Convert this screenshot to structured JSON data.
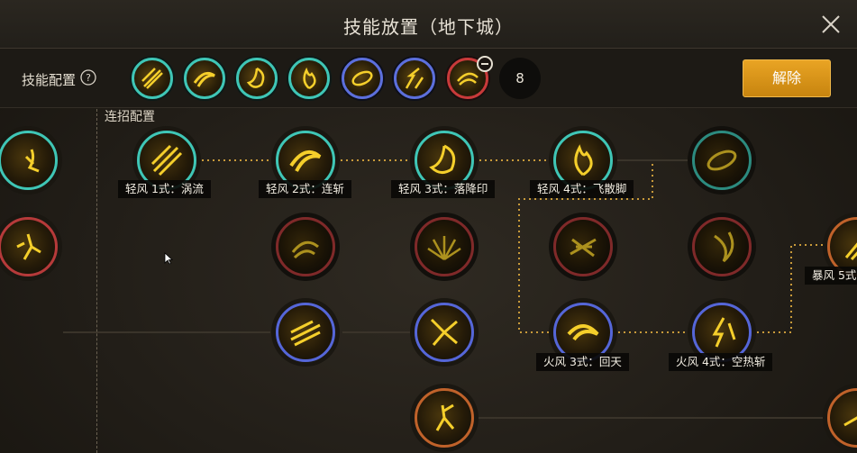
{
  "window": {
    "title": "技能放置（地下城）"
  },
  "config": {
    "label": "技能配置",
    "slots": [
      {
        "ring": "teal",
        "icon": "slash-skill-icon"
      },
      {
        "ring": "teal",
        "icon": "whirl-skill-icon"
      },
      {
        "ring": "teal",
        "icon": "swirl-skill-icon"
      },
      {
        "ring": "teal",
        "icon": "flame-skill-icon"
      },
      {
        "ring": "blue",
        "icon": "spin-skill-icon"
      },
      {
        "ring": "blue",
        "icon": "strike-skill-icon"
      },
      {
        "ring": "red",
        "icon": "dash-skill-icon"
      }
    ],
    "count": "8",
    "release_button": "解除"
  },
  "tree": {
    "combo_label": "连招配置",
    "labels": {
      "l1": "轻风 1式：涡流",
      "l2": "轻风 2式：连斩",
      "l3": "轻风 3式：落降印",
      "l4": "轻风 4式：飞散脚",
      "l5": "火风 3式：回天",
      "l6": "火风 4式：空热斩",
      "l7": "暴风 5式"
    }
  },
  "colors": {
    "teal": "#3fc6b6",
    "blue": "#5566d8",
    "red": "#b63a3a",
    "accent": "#e0a128"
  }
}
